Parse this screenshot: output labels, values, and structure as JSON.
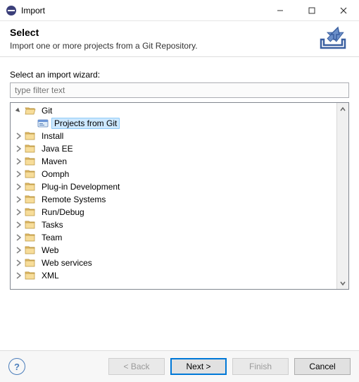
{
  "window": {
    "title": "Import"
  },
  "banner": {
    "heading": "Select",
    "description": "Import one or more projects from a Git Repository."
  },
  "filter": {
    "label": "Select an import wizard:",
    "placeholder": "type filter text",
    "value": ""
  },
  "tree": {
    "items": [
      {
        "label": "Git",
        "expanded": true,
        "indent": 0,
        "type": "folder",
        "children": [
          {
            "label": "Projects from Git",
            "indent": 1,
            "type": "wizard",
            "selected": true
          }
        ]
      },
      {
        "label": "Install",
        "expanded": false,
        "indent": 0,
        "type": "folder"
      },
      {
        "label": "Java EE",
        "expanded": false,
        "indent": 0,
        "type": "folder"
      },
      {
        "label": "Maven",
        "expanded": false,
        "indent": 0,
        "type": "folder"
      },
      {
        "label": "Oomph",
        "expanded": false,
        "indent": 0,
        "type": "folder"
      },
      {
        "label": "Plug-in Development",
        "expanded": false,
        "indent": 0,
        "type": "folder"
      },
      {
        "label": "Remote Systems",
        "expanded": false,
        "indent": 0,
        "type": "folder"
      },
      {
        "label": "Run/Debug",
        "expanded": false,
        "indent": 0,
        "type": "folder"
      },
      {
        "label": "Tasks",
        "expanded": false,
        "indent": 0,
        "type": "folder"
      },
      {
        "label": "Team",
        "expanded": false,
        "indent": 0,
        "type": "folder"
      },
      {
        "label": "Web",
        "expanded": false,
        "indent": 0,
        "type": "folder"
      },
      {
        "label": "Web services",
        "expanded": false,
        "indent": 0,
        "type": "folder"
      },
      {
        "label": "XML",
        "expanded": false,
        "indent": 0,
        "type": "folder"
      }
    ]
  },
  "buttons": {
    "back": "< Back",
    "next": "Next >",
    "finish": "Finish",
    "cancel": "Cancel",
    "help": "?"
  }
}
